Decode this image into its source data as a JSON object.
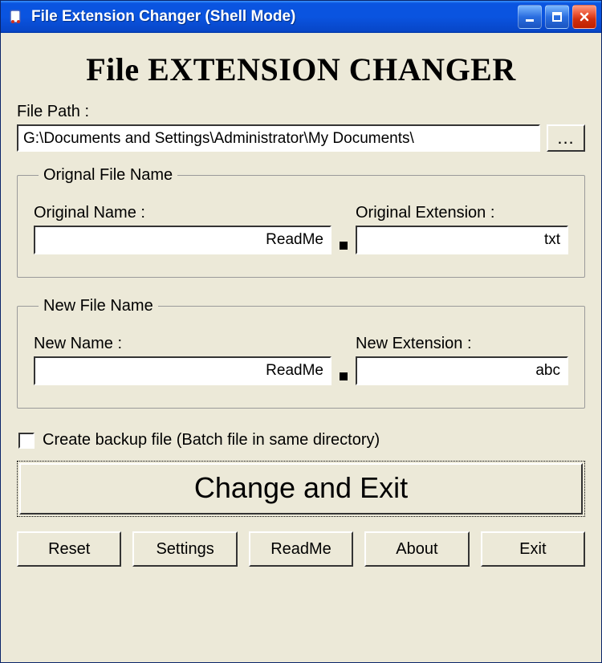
{
  "window": {
    "title": "File Extension Changer (Shell Mode)"
  },
  "heading": "File EXTENSION CHANGER",
  "filepath": {
    "label": "File Path :",
    "value": "G:\\Documents and Settings\\Administrator\\My Documents\\",
    "browse_label": "..."
  },
  "original_group": {
    "legend": "Orignal File Name",
    "name_label": "Original Name :",
    "name_value": "ReadMe",
    "ext_label": "Original Extension :",
    "ext_value": "txt"
  },
  "new_group": {
    "legend": "New File Name",
    "name_label": "New Name :",
    "name_value": "ReadMe",
    "ext_label": "New Extension :",
    "ext_value": "abc"
  },
  "backup": {
    "checked": false,
    "label": "Create backup file (Batch file in same directory)"
  },
  "primary_button": "Change and Exit",
  "buttons": {
    "reset": "Reset",
    "settings": "Settings",
    "readme": "ReadMe",
    "about": "About",
    "exit": "Exit"
  }
}
